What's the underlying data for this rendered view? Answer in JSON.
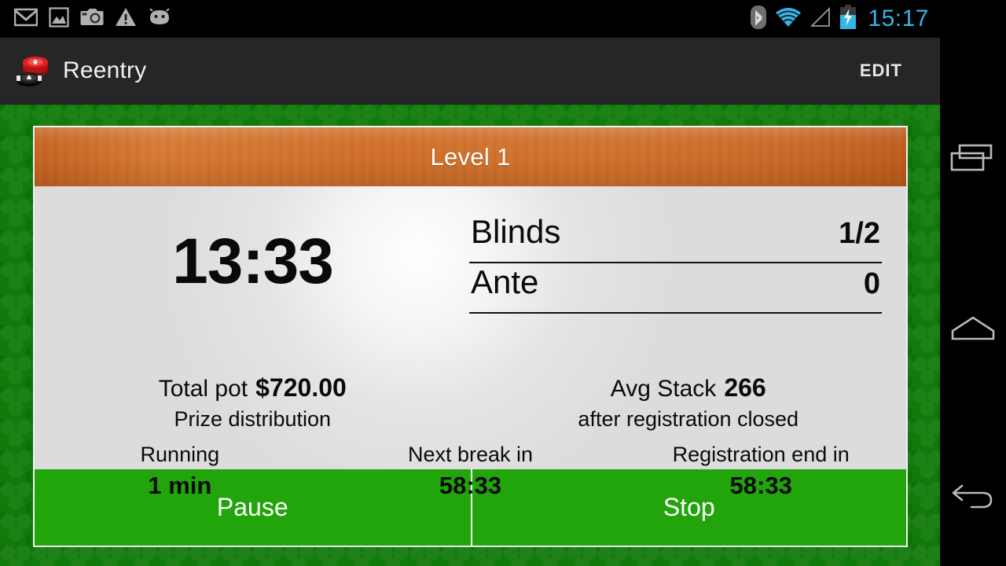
{
  "status_bar": {
    "left_icons": [
      {
        "name": "gmail-icon",
        "label": "Gmail notification"
      },
      {
        "name": "gallery-icon",
        "label": "Gallery notification"
      },
      {
        "name": "camera-icon",
        "label": "Camera notification"
      },
      {
        "name": "warning-icon",
        "label": "Warning notification"
      },
      {
        "name": "android-icon",
        "label": "Android notification"
      }
    ],
    "right_icons": [
      {
        "name": "bluetooth-icon",
        "label": "Bluetooth"
      },
      {
        "name": "wifi-icon",
        "label": "Wi-Fi"
      },
      {
        "name": "cellular-signal-icon",
        "label": "No signal"
      },
      {
        "name": "battery-charging-icon",
        "label": "Battery charging"
      }
    ],
    "clock": "15:17",
    "clock_color": "#33b5e5"
  },
  "action_bar": {
    "app_icon_name": "poker-chips-icon",
    "title": "Reentry",
    "edit_label": "EDIT",
    "background": "#262626"
  },
  "nav_bar": {
    "recents_label": "Recent apps",
    "home_label": "Home",
    "back_label": "Back"
  },
  "tournament": {
    "level_title": "Level 1",
    "header_color": "#cf6d27",
    "timer": "13:33",
    "rows": [
      {
        "label": "Blinds",
        "value": "1/2"
      },
      {
        "label": "Ante",
        "value": "0"
      }
    ],
    "pot": {
      "label": "Total pot",
      "value": "$720.00",
      "sub": "Prize distribution"
    },
    "avg_stack": {
      "label": "Avg Stack",
      "value": "266",
      "sub": "after registration closed"
    },
    "stats": [
      {
        "label": "Running",
        "value": "1 min"
      },
      {
        "label": "Next break in",
        "value": "58:33"
      },
      {
        "label": "Registration end in",
        "value": "58:33"
      }
    ],
    "actions": {
      "pause_label": "Pause",
      "stop_label": "Stop",
      "button_color": "#21a50b"
    }
  },
  "background": {
    "felt_color": "#107a0a"
  }
}
